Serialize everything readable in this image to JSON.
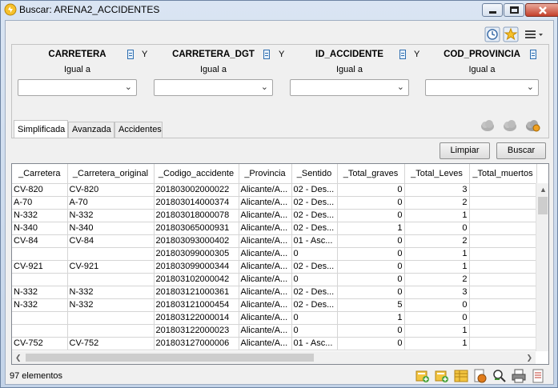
{
  "window": {
    "title": "Buscar: ARENA2_ACCIDENTES"
  },
  "toolbar_icons": [
    "history-icon",
    "favorites-star-icon",
    "menu-icon"
  ],
  "filters": {
    "operator_label": "Igual a",
    "conjunction": "Y",
    "fields": [
      {
        "name": "CARRETERA",
        "operator": "Igual a",
        "value": ""
      },
      {
        "name": "CARRETERA_DGT",
        "operator": "Igual a",
        "value": ""
      },
      {
        "name": "ID_ACCIDENTE",
        "operator": "Igual a",
        "value": ""
      },
      {
        "name": "COD_PROVINCIA",
        "operator": "Igual a",
        "value": ""
      }
    ]
  },
  "tabs": [
    "Simplificada",
    "Avanzada",
    "Accidentes"
  ],
  "active_tab": "Simplificada",
  "buttons": {
    "clear": "Limpiar",
    "search": "Buscar"
  },
  "table": {
    "columns": [
      "_Carretera",
      "_Carretera_original",
      "_Codigo_accidente",
      "_Provincia",
      "_Sentido",
      "_Total_graves",
      "_Total_Leves",
      "_Total_muertos"
    ],
    "rows": [
      [
        "CV-820",
        "CV-820",
        "201803002000022",
        "Alicante/A...",
        "02 - Des...",
        "0",
        "3",
        ""
      ],
      [
        "A-70",
        "A-70",
        "201803014000374",
        "Alicante/A...",
        "02 - Des...",
        "0",
        "2",
        ""
      ],
      [
        "N-332",
        "N-332",
        "201803018000078",
        "Alicante/A...",
        "02 - Des...",
        "0",
        "1",
        ""
      ],
      [
        "N-340",
        "N-340",
        "201803065000931",
        "Alicante/A...",
        "02 - Des...",
        "1",
        "0",
        ""
      ],
      [
        "CV-84",
        "CV-84",
        "201803093000402",
        "Alicante/A...",
        "01 - Asc...",
        "0",
        "2",
        ""
      ],
      [
        "",
        "",
        "201803099000305",
        "Alicante/A...",
        "0",
        "0",
        "1",
        ""
      ],
      [
        "CV-921",
        "CV-921",
        "201803099000344",
        "Alicante/A...",
        "02 - Des...",
        "0",
        "1",
        ""
      ],
      [
        "",
        "",
        "201803102000042",
        "Alicante/A...",
        "0",
        "0",
        "2",
        ""
      ],
      [
        "N-332",
        "N-332",
        "201803121000361",
        "Alicante/A...",
        "02 - Des...",
        "0",
        "3",
        ""
      ],
      [
        "N-332",
        "N-332",
        "201803121000454",
        "Alicante/A...",
        "02 - Des...",
        "5",
        "0",
        ""
      ],
      [
        "",
        "",
        "201803122000014",
        "Alicante/A...",
        "0",
        "1",
        "0",
        ""
      ],
      [
        "",
        "",
        "201803122000023",
        "Alicante/A...",
        "0",
        "0",
        "1",
        ""
      ],
      [
        "CV-752",
        "CV-752",
        "201803127000006",
        "Alicante/A...",
        "01 - Asc...",
        "0",
        "1",
        ""
      ]
    ]
  },
  "status": {
    "count_text": "97 elementos"
  },
  "bottom_icons": [
    "add-layer-icon",
    "add-layer-alt-icon",
    "table-icon",
    "export-icon",
    "zoom-to-icon",
    "print-icon",
    "report-icon"
  ]
}
